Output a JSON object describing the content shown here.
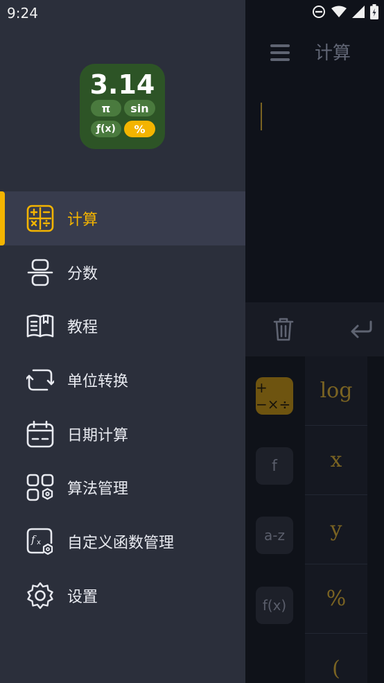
{
  "status_bar": {
    "time": "9:24"
  },
  "logo": {
    "number": "3.14",
    "pills": [
      "π",
      "sin",
      "ƒ(x)",
      "%"
    ]
  },
  "drawer": {
    "items": [
      {
        "label": "计算",
        "icon": "calculator-icon",
        "active": true
      },
      {
        "label": "分数",
        "icon": "fraction-icon"
      },
      {
        "label": "教程",
        "icon": "book-icon"
      },
      {
        "label": "单位转换",
        "icon": "convert-icon"
      },
      {
        "label": "日期计算",
        "icon": "calendar-icon"
      },
      {
        "label": "算法管理",
        "icon": "algorithm-icon"
      },
      {
        "label": "自定义函数管理",
        "icon": "custom-function-icon"
      },
      {
        "label": "设置",
        "icon": "gear-icon"
      }
    ]
  },
  "background": {
    "title": "计算",
    "left_keys": [
      "+−×÷",
      "f",
      "a-z",
      "f(x)"
    ],
    "keys": [
      "log",
      "x",
      "y",
      "%",
      "("
    ]
  },
  "colors": {
    "accent": "#f4b400",
    "drawer_bg": "#2b2f3b",
    "active_bg": "#383c4d",
    "logo_bg": "#2d5426"
  }
}
